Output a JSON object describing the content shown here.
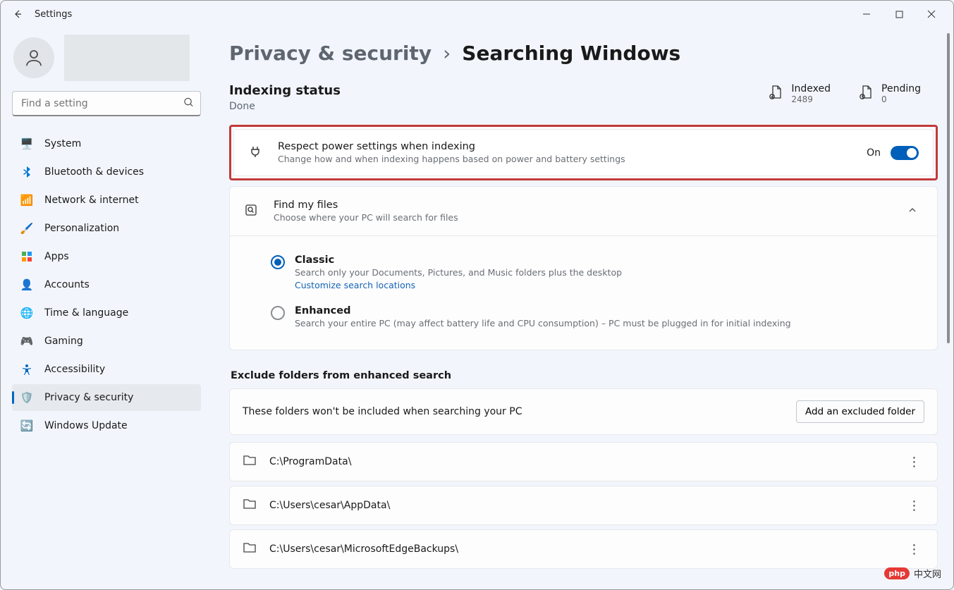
{
  "titlebar": {
    "title": "Settings"
  },
  "search": {
    "placeholder": "Find a setting"
  },
  "nav": {
    "items": [
      {
        "label": "System",
        "icon": "🖥️"
      },
      {
        "label": "Bluetooth & devices",
        "icon": "bt"
      },
      {
        "label": "Network & internet",
        "icon": "📶"
      },
      {
        "label": "Personalization",
        "icon": "🖌️"
      },
      {
        "label": "Apps",
        "icon": "app"
      },
      {
        "label": "Accounts",
        "icon": "👤"
      },
      {
        "label": "Time & language",
        "icon": "🌐"
      },
      {
        "label": "Gaming",
        "icon": "🎮"
      },
      {
        "label": "Accessibility",
        "icon": "acc"
      },
      {
        "label": "Privacy & security",
        "icon": "🛡️"
      },
      {
        "label": "Windows Update",
        "icon": "🔄"
      }
    ],
    "active_index": 9
  },
  "breadcrumb": {
    "parent": "Privacy & security",
    "current": "Searching Windows"
  },
  "indexing": {
    "heading": "Indexing status",
    "status": "Done",
    "indexed_label": "Indexed",
    "indexed_value": "2489",
    "pending_label": "Pending",
    "pending_value": "0"
  },
  "power_card": {
    "title": "Respect power settings when indexing",
    "subtitle": "Change how and when indexing happens based on power and battery settings",
    "state_label": "On"
  },
  "find_card": {
    "title": "Find my files",
    "subtitle": "Choose where your PC will search for files",
    "options": [
      {
        "label": "Classic",
        "desc": "Search only your Documents, Pictures, and Music folders plus the desktop",
        "link": "Customize search locations",
        "selected": true
      },
      {
        "label": "Enhanced",
        "desc": "Search your entire PC (may affect battery life and CPU consumption) – PC must be plugged in for initial indexing",
        "selected": false
      }
    ]
  },
  "exclude": {
    "heading": "Exclude folders from enhanced search",
    "intro": "These folders won't be included when searching your PC",
    "add_button": "Add an excluded folder",
    "folders": [
      "C:\\ProgramData\\",
      "C:\\Users\\cesar\\AppData\\",
      "C:\\Users\\cesar\\MicrosoftEdgeBackups\\"
    ]
  },
  "watermark": {
    "text": "中文网"
  }
}
